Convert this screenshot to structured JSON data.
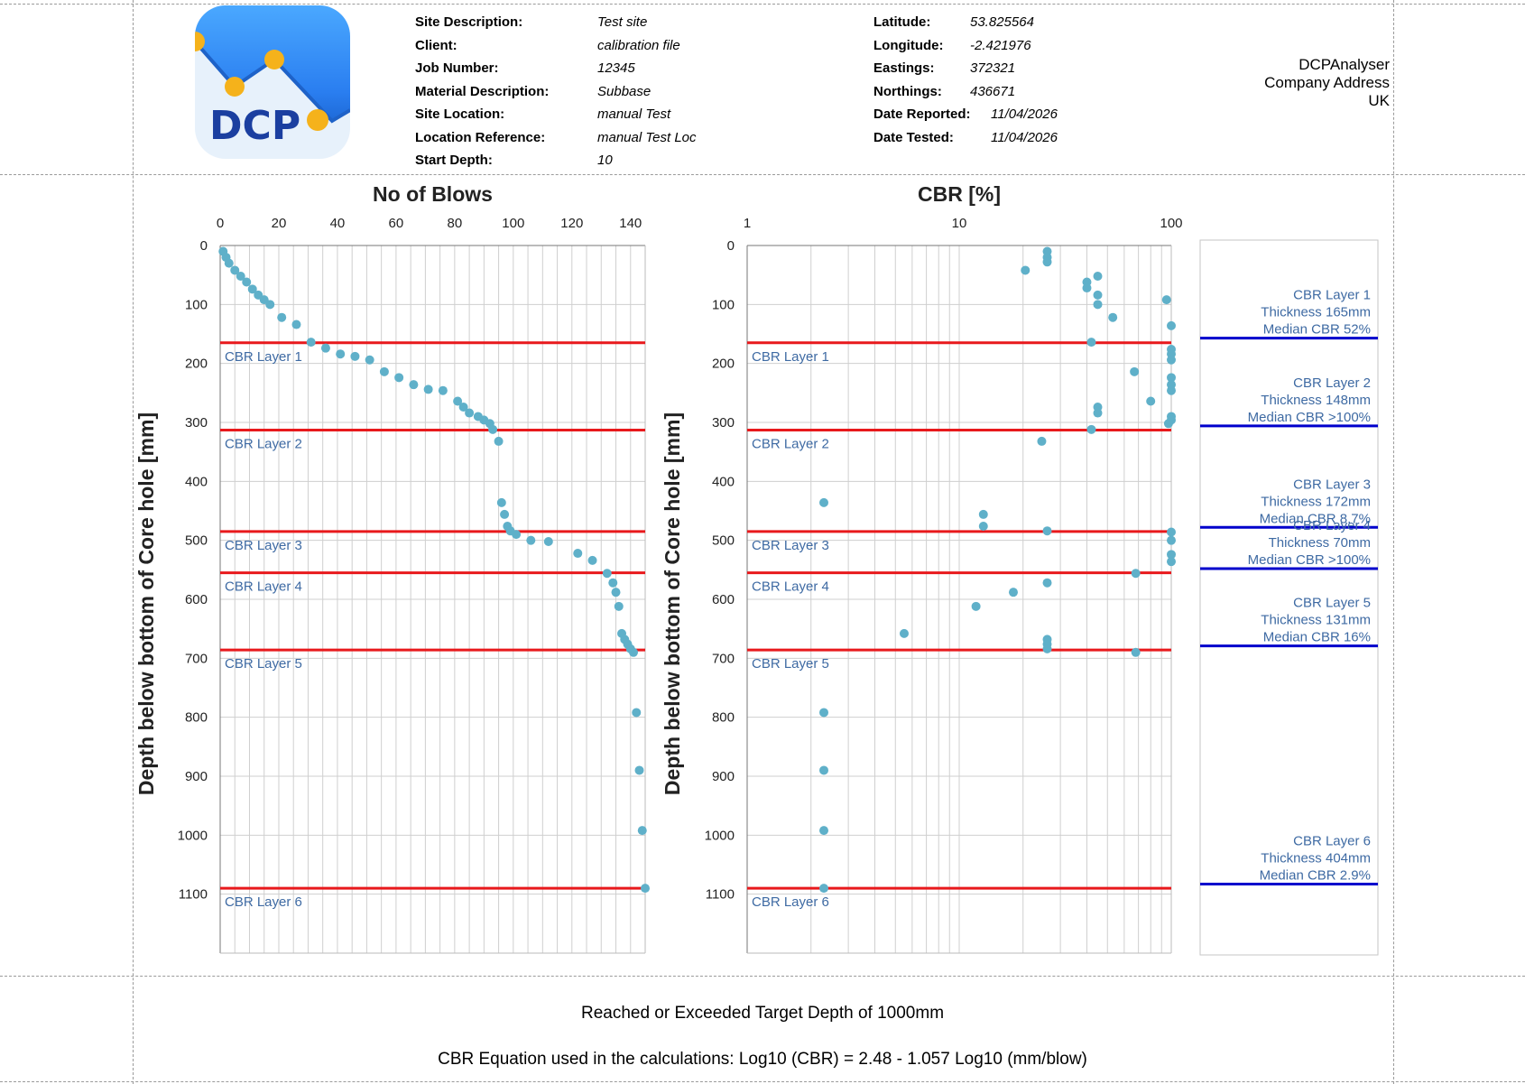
{
  "logo": {
    "text": "DCP"
  },
  "info_left": [
    {
      "label": "Site Description:",
      "value": "Test  site"
    },
    {
      "label": "Client:",
      "value": "calibration file"
    },
    {
      "label": "Job Number:",
      "value": "12345"
    },
    {
      "label": "Material Description:",
      "value": "Subbase"
    },
    {
      "label": "Site Location:",
      "value": "manual Test"
    },
    {
      "label": "Location Reference:",
      "value": "manual Test Loc"
    },
    {
      "label": "Start Depth:",
      "value": "10"
    }
  ],
  "info_right": [
    {
      "label": "Latitude:",
      "value": "53.825564"
    },
    {
      "label": "Longitude:",
      "value": "-2.421976"
    },
    {
      "label": "Eastings:",
      "value": "372321"
    },
    {
      "label": "Northings:",
      "value": "436671"
    },
    {
      "label": "Date Reported:",
      "value": "11/04/2026"
    },
    {
      "label": "Date Tested:",
      "value": "11/04/2026"
    }
  ],
  "company": {
    "name": "DCPAnalyser",
    "address": "Company Address",
    "country": "UK"
  },
  "chart_data": [
    {
      "type": "scatter",
      "title": "No of Blows",
      "ylabel": "Depth below bottom of Core hole [mm]",
      "xlabel": "",
      "xlim": [
        0,
        145
      ],
      "ylim": [
        0,
        1200
      ],
      "x_ticks": [
        0,
        20,
        40,
        60,
        80,
        100,
        120,
        140
      ],
      "y_ticks": [
        0,
        100,
        200,
        300,
        400,
        500,
        600,
        700,
        800,
        900,
        1000,
        1100
      ],
      "grid": true,
      "point_color": "#5fb0c9",
      "layer_line_color": "#e8191c",
      "points": [
        [
          1,
          10
        ],
        [
          2,
          20
        ],
        [
          3,
          30
        ],
        [
          5,
          42
        ],
        [
          7,
          52
        ],
        [
          9,
          62
        ],
        [
          11,
          74
        ],
        [
          13,
          84
        ],
        [
          15,
          92
        ],
        [
          17,
          100
        ],
        [
          21,
          122
        ],
        [
          26,
          134
        ],
        [
          31,
          164
        ],
        [
          36,
          174
        ],
        [
          41,
          184
        ],
        [
          46,
          188
        ],
        [
          51,
          194
        ],
        [
          56,
          214
        ],
        [
          61,
          224
        ],
        [
          66,
          236
        ],
        [
          71,
          244
        ],
        [
          76,
          246
        ],
        [
          81,
          264
        ],
        [
          83,
          274
        ],
        [
          85,
          284
        ],
        [
          88,
          290
        ],
        [
          90,
          296
        ],
        [
          92,
          302
        ],
        [
          93,
          312
        ],
        [
          95,
          332
        ],
        [
          96,
          436
        ],
        [
          97,
          456
        ],
        [
          98,
          476
        ],
        [
          99,
          484
        ],
        [
          101,
          490
        ],
        [
          106,
          500
        ],
        [
          112,
          502
        ],
        [
          122,
          522
        ],
        [
          127,
          534
        ],
        [
          132,
          556
        ],
        [
          134,
          572
        ],
        [
          135,
          588
        ],
        [
          136,
          612
        ],
        [
          137,
          658
        ],
        [
          138,
          668
        ],
        [
          139,
          676
        ],
        [
          140,
          684
        ],
        [
          141,
          690
        ],
        [
          142,
          792
        ],
        [
          143,
          890
        ],
        [
          144,
          992
        ],
        [
          145,
          1090
        ]
      ],
      "layers": [
        {
          "label": "CBR Layer 1",
          "depth": 165
        },
        {
          "label": "CBR Layer 2",
          "depth": 313
        },
        {
          "label": "CBR Layer 3",
          "depth": 485
        },
        {
          "label": "CBR Layer 4",
          "depth": 555
        },
        {
          "label": "CBR Layer 5",
          "depth": 686
        },
        {
          "label": "CBR Layer 6",
          "depth": 1090
        }
      ]
    },
    {
      "type": "scatter",
      "title": "CBR [%]",
      "ylabel": "Depth below bottom of Core hole [mm]",
      "xlabel": "",
      "x_scale": "log",
      "xlim": [
        1,
        100
      ],
      "ylim": [
        0,
        1200
      ],
      "x_ticks": [
        1,
        10,
        100
      ],
      "y_ticks": [
        0,
        100,
        200,
        300,
        400,
        500,
        600,
        700,
        800,
        900,
        1000,
        1100
      ],
      "grid": true,
      "point_color": "#5fb0c9",
      "layer_line_color": "#e8191c",
      "points": [
        [
          26,
          10
        ],
        [
          26,
          20
        ],
        [
          26,
          28
        ],
        [
          20.5,
          42
        ],
        [
          45,
          52
        ],
        [
          40,
          62
        ],
        [
          40,
          72
        ],
        [
          45,
          84
        ],
        [
          45,
          100
        ],
        [
          53,
          122
        ],
        [
          95,
          92
        ],
        [
          100,
          136
        ],
        [
          42,
          164
        ],
        [
          100,
          176
        ],
        [
          100,
          184
        ],
        [
          100,
          194
        ],
        [
          67,
          214
        ],
        [
          100,
          224
        ],
        [
          100,
          236
        ],
        [
          100,
          246
        ],
        [
          80,
          264
        ],
        [
          45,
          274
        ],
        [
          45,
          284
        ],
        [
          100,
          290
        ],
        [
          100,
          296
        ],
        [
          97,
          302
        ],
        [
          42,
          312
        ],
        [
          24.5,
          332
        ],
        [
          2.3,
          436
        ],
        [
          13,
          456
        ],
        [
          13,
          476
        ],
        [
          26,
          484
        ],
        [
          100,
          486
        ],
        [
          100,
          500
        ],
        [
          100,
          524
        ],
        [
          100,
          536
        ],
        [
          68,
          556
        ],
        [
          26,
          572
        ],
        [
          18,
          588
        ],
        [
          12,
          612
        ],
        [
          5.5,
          658
        ],
        [
          26,
          668
        ],
        [
          26,
          676
        ],
        [
          26,
          684
        ],
        [
          68,
          690
        ],
        [
          2.3,
          792
        ],
        [
          2.3,
          890
        ],
        [
          2.3,
          992
        ],
        [
          2.3,
          1090
        ]
      ],
      "layers": [
        {
          "label": "CBR Layer 1",
          "depth": 165
        },
        {
          "label": "CBR Layer 2",
          "depth": 313
        },
        {
          "label": "CBR Layer 3",
          "depth": 485
        },
        {
          "label": "CBR Layer 4",
          "depth": 555
        },
        {
          "label": "CBR Layer 5",
          "depth": 686
        },
        {
          "label": "CBR Layer 6",
          "depth": 1090
        }
      ]
    }
  ],
  "summary_panel": {
    "line_color": "#0000cc",
    "layers": [
      {
        "name": "CBR Layer 1",
        "thickness": "Thickness 165mm",
        "median": "Median CBR 52%",
        "depth": 157
      },
      {
        "name": "CBR Layer 2",
        "thickness": "Thickness 148mm",
        "median": "Median CBR >100%",
        "depth": 306
      },
      {
        "name": "CBR Layer 3",
        "thickness": "Thickness 172mm",
        "median": "Median CBR 8.7%",
        "depth": 478
      },
      {
        "name": "CBR Layer 4",
        "thickness": "Thickness 70mm",
        "median": "Median CBR >100%",
        "depth": 548
      },
      {
        "name": "CBR Layer 5",
        "thickness": "Thickness 131mm",
        "median": "Median CBR 16%",
        "depth": 679
      },
      {
        "name": "CBR Layer 6",
        "thickness": "Thickness 404mm",
        "median": "Median CBR 2.9%",
        "depth": 1083
      }
    ]
  },
  "footer": {
    "target": "Reached or Exceeded Target Depth of 1000mm",
    "equation": "CBR Equation used in the calculations: Log10 (CBR) = 2.48 - 1.057 Log10 (mm/blow)"
  }
}
